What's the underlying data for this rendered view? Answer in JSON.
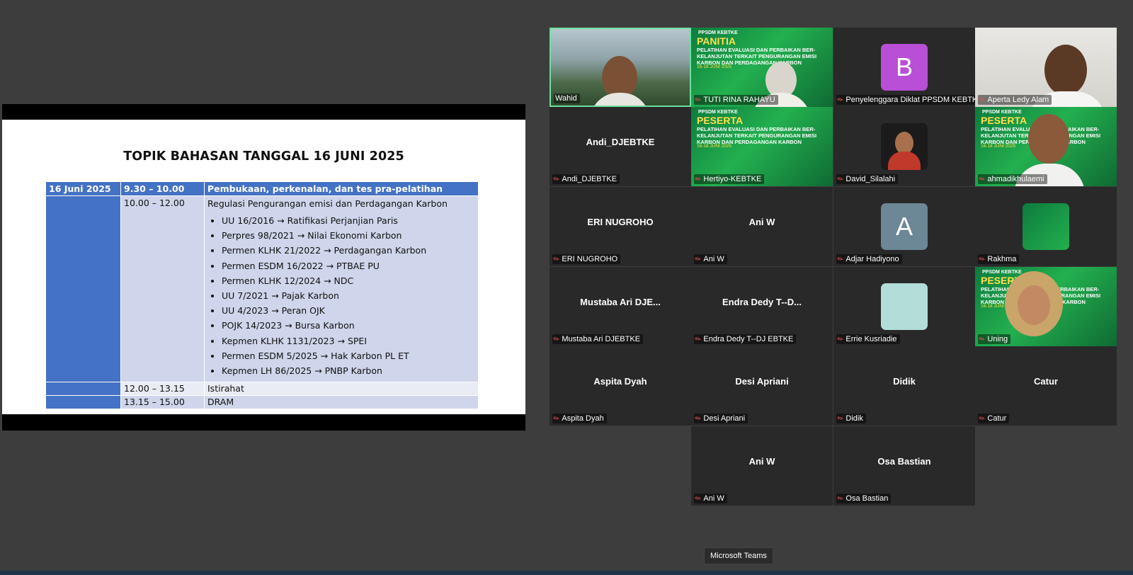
{
  "slide": {
    "title": "TOPIK BAHASAN TANGGAL 16 JUNI 2025",
    "header": {
      "date": "16 Juni 2025",
      "time": "9.30 – 10.00",
      "topic": "Pembukaan, perkenalan, dan tes pra-pelatihan"
    },
    "row2": {
      "time": "10.00 – 12.00",
      "topic": "Regulasi Pengurangan emisi dan Perdagangan Karbon",
      "items": [
        "UU 16/2016 → Ratifikasi Perjanjian Paris",
        "Perpres 98/2021 → Nilai Ekonomi Karbon",
        "Permen KLHK 21/2022 → Perdagangan Karbon",
        "Permen ESDM 16/2022 → PTBAE PU",
        "Permen KLHK 12/2024 → NDC",
        "UU 7/2021 → Pajak Karbon",
        "UU 4/2023 → Peran OJK",
        "POJK 14/2023 → Bursa Karbon",
        "Kepmen KLHK 1131/2023 → SPEI",
        "Permen ESDM 5/2025 → Hak Karbon PL ET",
        "Kepmen LH 86/2025 → PNBP Karbon"
      ]
    },
    "row3": {
      "time": "12.00 – 13.15",
      "topic": "Istirahat"
    },
    "row4": {
      "time": "13.15 – 15.00",
      "topic": "DRAM"
    }
  },
  "banner": {
    "org": "PPSDM KEBTKE",
    "role_panitia": "PANITIA",
    "role_peserta": "PESERTA",
    "title": "PELATIHAN EVALUASI DAN PERBAIKAN BER-KELANJUTAN TERKAIT PENGURANGAN EMISI KARBON DAN PERDAGANGAN KARBON",
    "dates": "16-18 JUNI 2025"
  },
  "participants": {
    "wahid": "Wahid",
    "tuti": "TUTI RINA RAHAYU",
    "penyelenggara": "Penyelenggara Diklat PPSDM KEBTKE",
    "penyelenggara_initial": "B",
    "aperta": "Aperta Ledy Alam",
    "andi": "Andi_DJEBTKE",
    "hertiyo": "Hertiyo-KEBTKE",
    "david": "David_Silalahi",
    "ahmad": "ahmadikhulaemi",
    "eri": "ERI NUGROHO",
    "aniw": "Ani W",
    "adjar": "Adjar Hadiyono",
    "adjar_initial": "A",
    "rakhma": "Rakhma",
    "mustaba_tile": "Mustaba Ari DJE...",
    "mustaba": "Mustaba Ari DJEBTKE",
    "endra_tile": "Endra Dedy T--D...",
    "endra": "Endra Dedy T--DJ EBTKE",
    "errie": "Errie Kusriadie",
    "uning": "Uning",
    "aspita": "Aspita Dyah",
    "desi": "Desi Apriani",
    "didik": "Didik",
    "catur": "Catur",
    "aniw2": "Ani W",
    "osa": "Osa Bastian"
  },
  "tooltip": "Microsoft Teams",
  "colors": {
    "table_header": "#4472c4",
    "table_light": "#cfd5ea",
    "tile_bg": "#292929",
    "speaking": "#6ee0a0",
    "avatar_b": "#b84fd6",
    "avatar_a": "#6c8796"
  }
}
